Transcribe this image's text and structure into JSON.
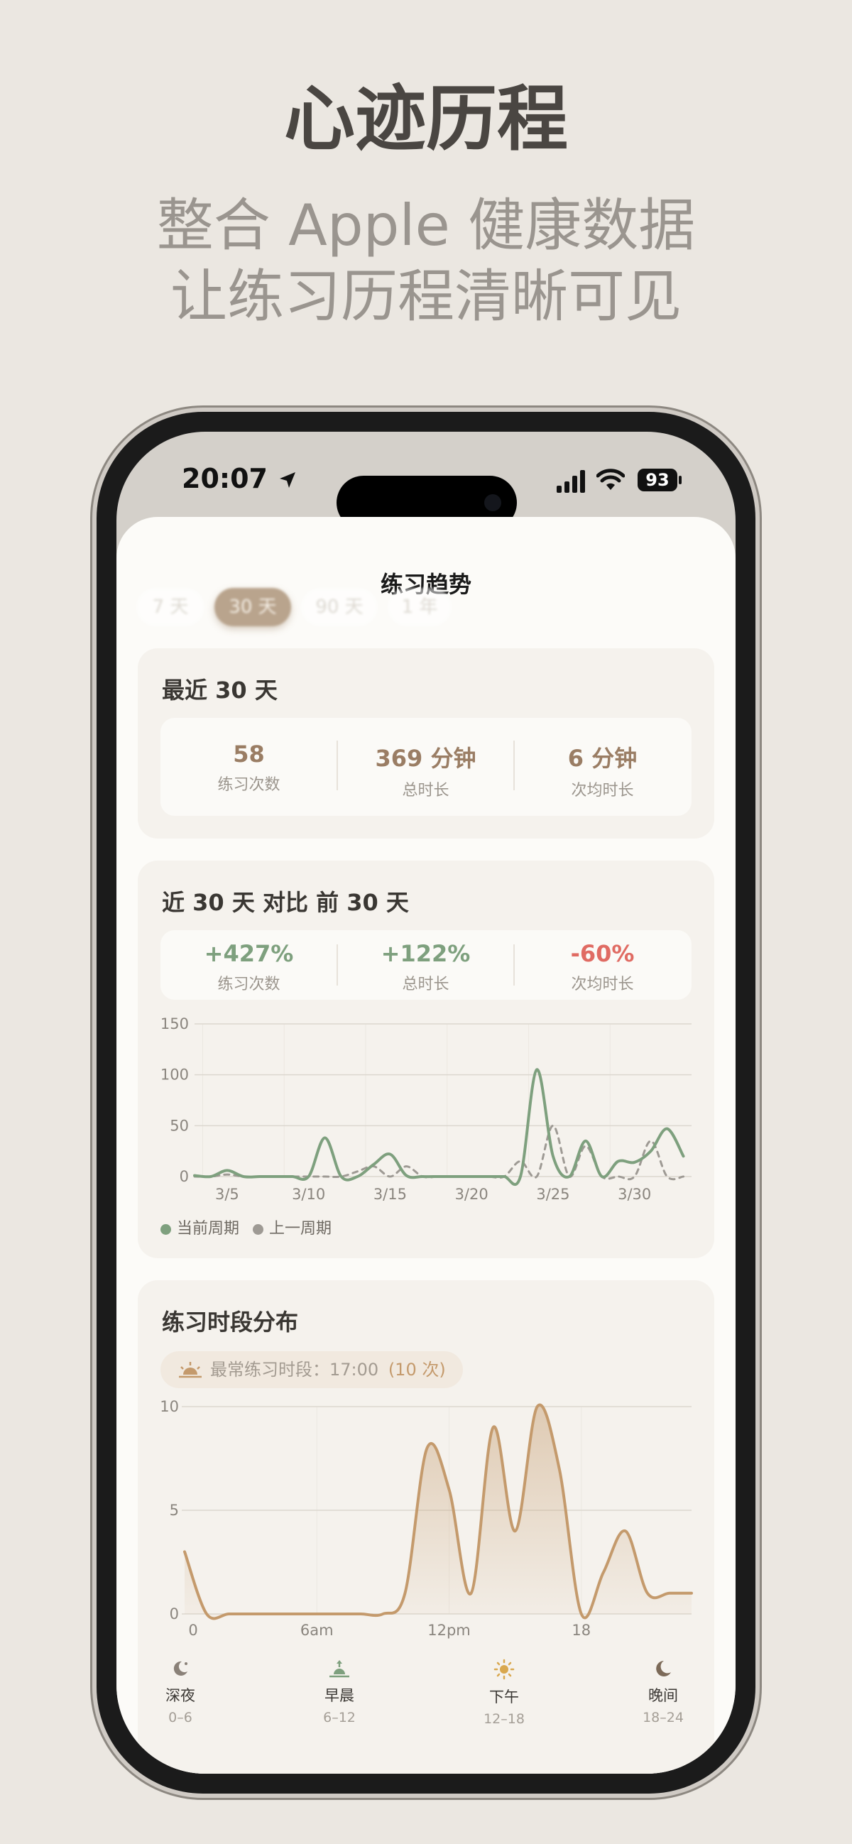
{
  "promo": {
    "title": "心迹历程",
    "subtitle_line1": "整合 Apple 健康数据",
    "subtitle_line2": "让练习历程清晰可见"
  },
  "status_bar": {
    "time": "20:07",
    "battery": "93"
  },
  "sheet": {
    "title": "练习趋势",
    "range_tabs": [
      "7 天",
      "30 天",
      "90 天",
      "1 年"
    ],
    "selected_tab": "30 天"
  },
  "summary": {
    "title": "最近 30 天",
    "stats": [
      {
        "value": "58",
        "label": "练习次数"
      },
      {
        "value": "369 分钟",
        "label": "总时长"
      },
      {
        "value": "6 分钟",
        "label": "次均时长"
      }
    ]
  },
  "comparison": {
    "title": "近 30 天 对比 前 30 天",
    "stats": [
      {
        "value": "+427%",
        "label": "练习次数"
      },
      {
        "value": "+122%",
        "label": "总时长"
      },
      {
        "value": "-60%",
        "label": "次均时长"
      }
    ],
    "legend": [
      "当前周期",
      "上一周期"
    ]
  },
  "distribution": {
    "title": "练习时段分布",
    "peak_text": "最常练习时段：17:00",
    "peak_count": "(10 次)",
    "periods": [
      {
        "name": "深夜",
        "range": "0–6",
        "icon": "moon-star-icon"
      },
      {
        "name": "早晨",
        "range": "6–12",
        "icon": "sunrise-icon"
      },
      {
        "name": "下午",
        "range": "12–18",
        "icon": "sun-icon"
      },
      {
        "name": "晚间",
        "range": "18–24",
        "icon": "moon-icon"
      }
    ]
  },
  "colors": {
    "positive": "#7ea07e",
    "negative": "#e06b63",
    "accent_brown": "#9a7d64",
    "area_fill": "#c49a6c"
  },
  "chart_data": [
    {
      "type": "line",
      "ylim": [
        0,
        150
      ],
      "yticks": [
        0,
        50,
        100,
        150
      ],
      "xticks": [
        "3/5",
        "3/10",
        "3/15",
        "3/20",
        "3/25",
        "3/30"
      ],
      "grid": true,
      "legend_placement": "bottom-left",
      "series": [
        {
          "name": "当前周期",
          "color": "#7ea07e",
          "style": "solid",
          "x": [
            3,
            4,
            5,
            6,
            7,
            8,
            9,
            10,
            11,
            12,
            13,
            14,
            15,
            16,
            17,
            18,
            19,
            20,
            21,
            22,
            23,
            24,
            25,
            26,
            27,
            28,
            29,
            30,
            31,
            32,
            33
          ],
          "values": [
            1,
            0,
            6,
            0,
            0,
            0,
            0,
            0,
            38,
            0,
            0,
            12,
            22,
            1,
            0,
            0,
            0,
            0,
            0,
            0,
            0,
            105,
            20,
            0,
            35,
            0,
            15,
            14,
            25,
            47,
            20
          ]
        },
        {
          "name": "上一周期",
          "color": "#9e9a94",
          "style": "dashed",
          "x": [
            3,
            4,
            5,
            6,
            7,
            8,
            9,
            10,
            11,
            12,
            13,
            14,
            15,
            16,
            17,
            18,
            19,
            20,
            21,
            22,
            23,
            24,
            25,
            26,
            27,
            28,
            29,
            30,
            31,
            32,
            33
          ],
          "values": [
            0,
            0,
            2,
            0,
            0,
            0,
            0,
            0,
            0,
            0,
            5,
            10,
            0,
            10,
            0,
            0,
            0,
            0,
            0,
            0,
            15,
            0,
            50,
            0,
            30,
            0,
            0,
            0,
            35,
            0,
            0
          ]
        }
      ]
    },
    {
      "type": "area",
      "ylim": [
        0,
        10
      ],
      "yticks": [
        0,
        5,
        10
      ],
      "xticks": [
        "0",
        "6am",
        "12pm",
        "18"
      ],
      "grid": true,
      "x": [
        0,
        1,
        2,
        3,
        4,
        5,
        6,
        7,
        8,
        9,
        10,
        11,
        12,
        13,
        14,
        15,
        16,
        17,
        18,
        19,
        20,
        21,
        22,
        23
      ],
      "values": [
        3,
        0,
        0,
        0,
        0,
        0,
        0,
        0,
        0,
        0,
        1,
        8,
        6,
        1,
        9,
        4,
        10,
        7,
        0,
        2,
        4,
        1,
        1,
        1
      ],
      "color": "#c49a6c"
    }
  ]
}
